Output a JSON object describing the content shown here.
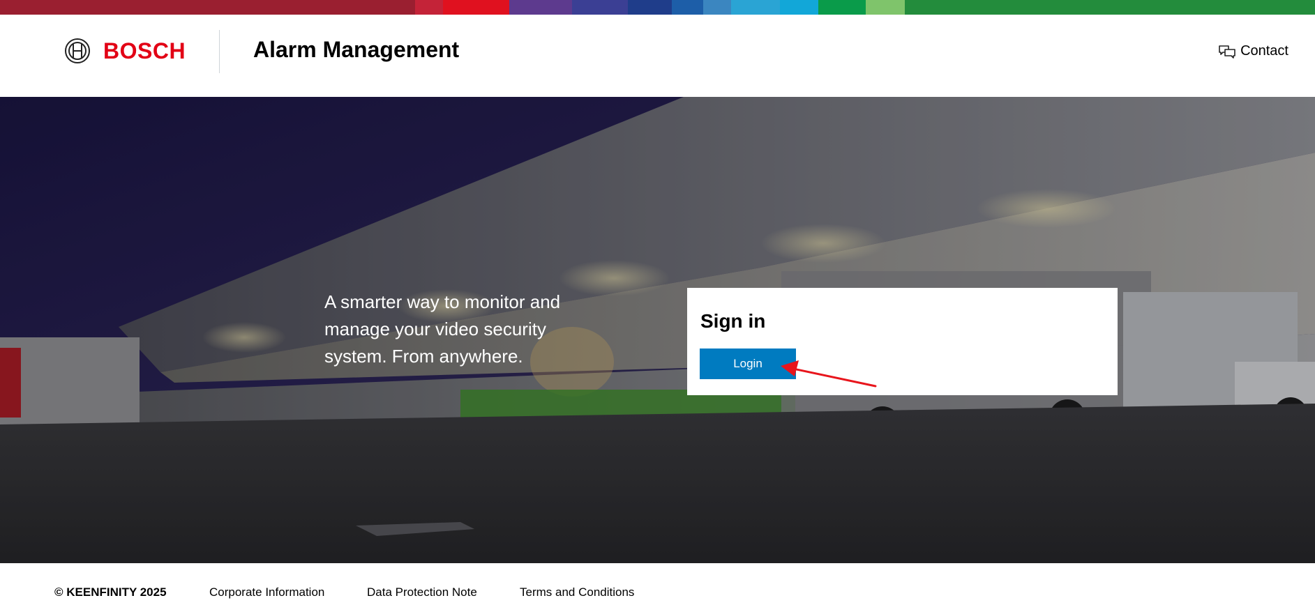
{
  "supergraphic": {
    "colors": [
      "#9a1f30",
      "#c42338",
      "#e0111f",
      "#5d3a8e",
      "#3b3f94",
      "#1f3d8a",
      "#1d5ea8",
      "#3b86c0",
      "#2aa4d4",
      "#12a7d8",
      "#0a9b4a",
      "#7fc46b",
      "#238c3c"
    ]
  },
  "header": {
    "brand": "BOSCH",
    "brand_color": "#e20015",
    "app_title": "Alarm Management",
    "contact_label": "Contact"
  },
  "hero": {
    "tagline": "A smarter way to monitor and manage your video security system. From anywhere."
  },
  "signin": {
    "title": "Sign in",
    "login_label": "Login",
    "button_color": "#007bc0"
  },
  "annotation": {
    "arrow_color": "#e8151c"
  },
  "footer": {
    "copyright": "© KEENFINITY 2025",
    "links": [
      "Corporate Information",
      "Data Protection Note",
      "Terms and Conditions"
    ]
  },
  "icons": {
    "logo": "bosch-armature-icon",
    "contact": "chat-bubbles-icon"
  }
}
